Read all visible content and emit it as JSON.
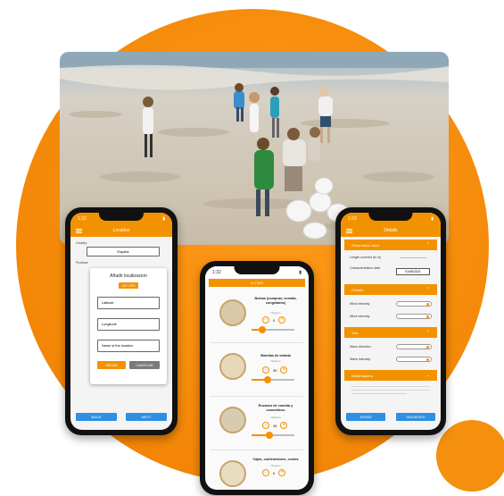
{
  "photo": {
    "alt": ""
  },
  "phone_location": {
    "status_time": "1:32",
    "title": "Location",
    "country_label": "Country",
    "country_value": "España",
    "province_label": "Province",
    "dialog_title": "Añadir localizacion",
    "get_gps_label": "GET GPS",
    "latitude_label": "Latitude",
    "longitude_label": "Longitude",
    "location_name_label": "Name of the location",
    "add_label": "AÑADIR",
    "cancel_label": "CANCELAR",
    "back_label": "BACK",
    "next_label": "NEXT"
  },
  "phone_list": {
    "status_time": "1:32",
    "tab_label": "ULTIMO",
    "items": [
      {
        "name": "Bolsas (compras, comida, congelados)",
        "sub": "Ninguno",
        "count": "0"
      },
      {
        "name": "Botellas de bebida",
        "sub": "Ninguno",
        "count": "30"
      },
      {
        "name": "Envases de comida y cosméticos",
        "sub": "Ninguno",
        "count": "34"
      },
      {
        "name": "Cajas, contenedores, cestos",
        "sub": "Ninguno",
        "count": "0"
      }
    ]
  },
  "phone_details": {
    "status_time": "1:33",
    "title": "Details",
    "sections": {
      "observation_area": "Observation area",
      "climate": "Climate",
      "sea": "Sea",
      "observations": "Observations"
    },
    "length_label": "Length covered (in m)",
    "characterization_label": "Characterization date",
    "characterization_value": "01/06/2021",
    "wind_intensity_label": "Wind intensity",
    "wind_intensity2_label": "Wind intensity",
    "wave_direction_label": "Wave direction",
    "wave_intensity_label": "Wave intensity",
    "back_label": "ATRÁS",
    "next_label": "SIGUIENTE"
  }
}
